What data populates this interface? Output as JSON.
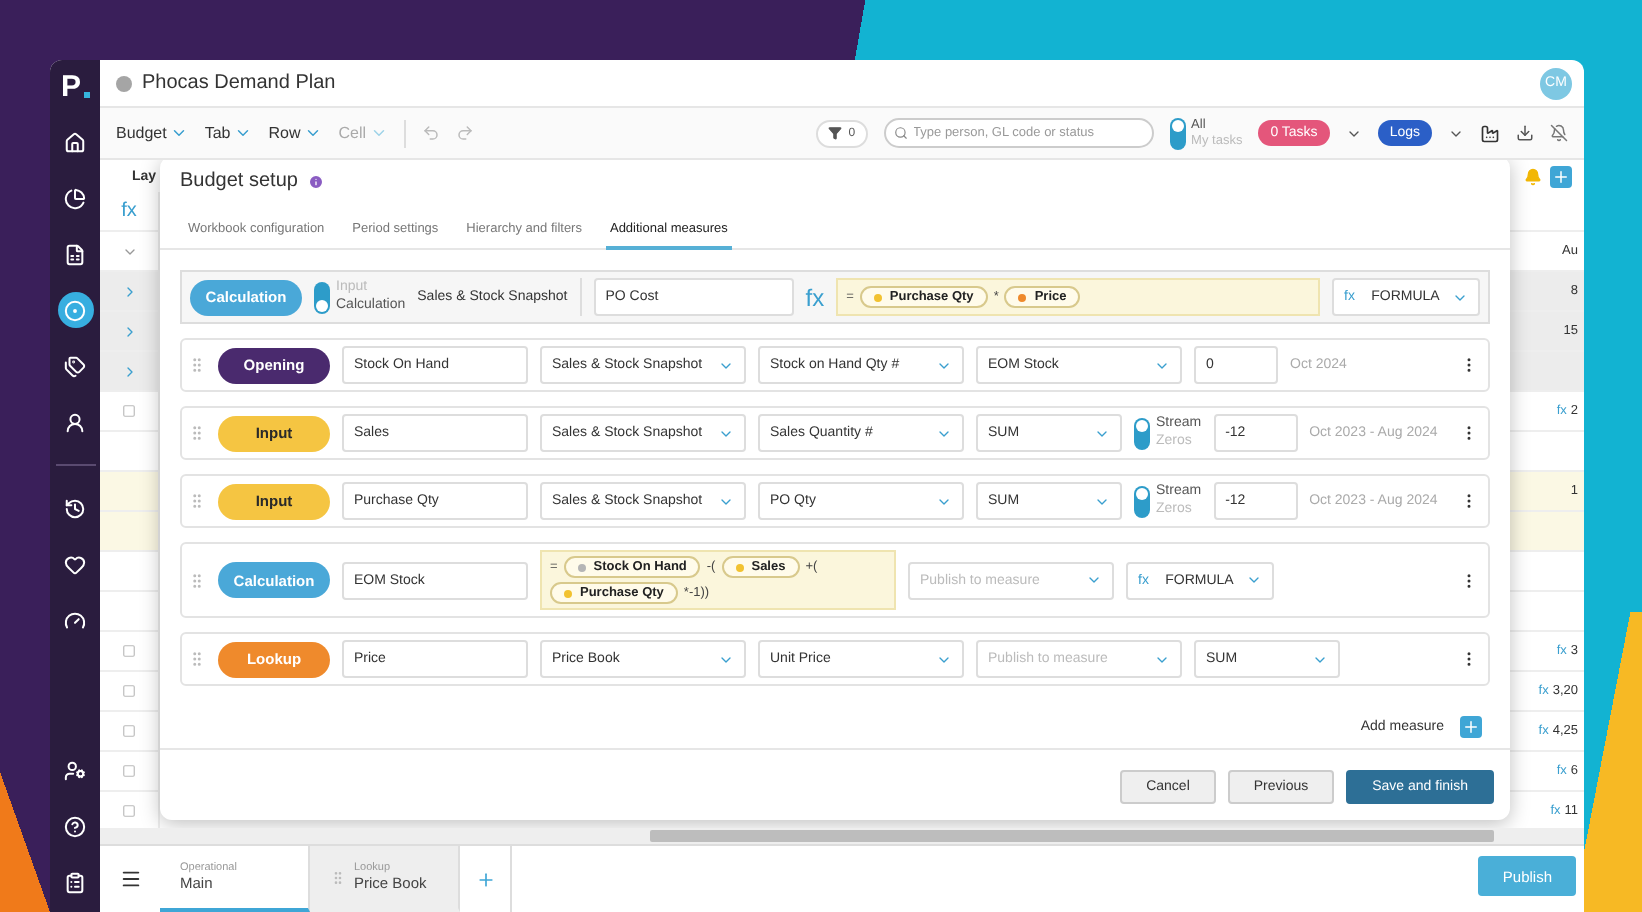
{
  "sidebar": {
    "logo": "P",
    "primary": [
      {
        "selected": false
      },
      {
        "selected": false
      },
      {
        "selected": false
      },
      {
        "selected": true
      },
      {
        "selected": false
      },
      {
        "selected": false
      }
    ],
    "secondary": [
      {
        "selected": false
      },
      {
        "selected": false
      },
      {
        "selected": false
      }
    ],
    "footer": [
      {
        "selected": false
      },
      {
        "selected": false
      },
      {
        "selected": false
      }
    ]
  },
  "window": {
    "title": "Phocas Demand Plan",
    "avatar": "CM"
  },
  "toolbar": {
    "menus": [
      {
        "label": "Budget",
        "disabled": false
      },
      {
        "label": "Tab",
        "disabled": false
      },
      {
        "label": "Row",
        "disabled": false
      },
      {
        "label": "Cell",
        "disabled": true
      }
    ],
    "filter_count": "0",
    "search": {
      "placeholder": "Type person, GL code or status"
    },
    "task_toggle": [
      {
        "label": "All",
        "selected": true
      },
      {
        "label": "My tasks",
        "selected": false
      }
    ],
    "tasks_badge": "0 Tasks",
    "logs": "Logs"
  },
  "sheet": {
    "header": "Lay",
    "rows": [
      {
        "fx": "fx",
        "shaded": false,
        "highlighted": false
      },
      {
        "kind": "chevron",
        "shaded": false,
        "highlighted": false,
        "value": "Au"
      },
      {
        "kind": "expand",
        "shaded": true,
        "highlighted": false,
        "value": "8"
      },
      {
        "kind": "expand",
        "shaded": true,
        "highlighted": false,
        "value": "15"
      },
      {
        "kind": "expand",
        "shaded": true,
        "highlighted": false
      },
      {
        "kind": "checkbox",
        "shaded": false,
        "highlighted": false,
        "prefix": "fx",
        "value": "2"
      },
      {
        "shaded": false,
        "highlighted": false
      },
      {
        "shaded": false,
        "highlighted": true,
        "value": "1"
      },
      {
        "shaded": false,
        "highlighted": true
      },
      {
        "shaded": false,
        "highlighted": false
      },
      {
        "shaded": false,
        "highlighted": false
      },
      {
        "kind": "checkbox",
        "shaded": false,
        "highlighted": false,
        "prefix": "fx",
        "value": "3"
      },
      {
        "kind": "checkbox",
        "shaded": false,
        "highlighted": false,
        "prefix": "fx",
        "value": "3,20"
      },
      {
        "kind": "checkbox",
        "shaded": false,
        "highlighted": false,
        "prefix": "fx",
        "value": "4,25"
      },
      {
        "kind": "checkbox",
        "shaded": false,
        "highlighted": false,
        "prefix": "fx",
        "value": "6"
      },
      {
        "kind": "checkbox",
        "shaded": false,
        "highlighted": false,
        "prefix": "fx",
        "value": "11"
      }
    ]
  },
  "dialog": {
    "title": "Budget setup",
    "tabs": [
      {
        "label": "Workbook configuration",
        "selected": false
      },
      {
        "label": "Period settings",
        "selected": false
      },
      {
        "label": "Hierarchy and filters",
        "selected": false
      },
      {
        "label": "Additional measures",
        "selected": true
      }
    ],
    "editor": {
      "type": "Calculation",
      "color": "#4aa8d8",
      "mode": [
        {
          "label": "Input",
          "selected": false
        },
        {
          "label": "Calculation",
          "selected": true
        }
      ],
      "source": "Sales & Stock Snapshot",
      "name": "PO Cost",
      "fx": "fx",
      "formula": [
        {
          "kind": "op",
          "text": "="
        },
        {
          "kind": "chip",
          "text": "Purchase Qty",
          "color": "#f2c230"
        },
        {
          "kind": "op",
          "text": "*"
        },
        {
          "kind": "chip",
          "text": "Price",
          "color": "#ef8a2c"
        }
      ],
      "method": {
        "prefix": "fx",
        "value": "FORMULA"
      }
    },
    "measures": [
      {
        "type": "Opening",
        "color": "#4a2a6e",
        "name": "Stock On Hand",
        "cells": [
          {
            "kind": "select",
            "value": "Sales & Stock Snapshot"
          },
          {
            "kind": "select",
            "value": "Stock on Hand Qty #"
          },
          {
            "kind": "select",
            "value": "EOM Stock"
          },
          {
            "kind": "input",
            "value": "0"
          },
          {
            "kind": "period",
            "value": "Oct 2024"
          }
        ]
      },
      {
        "type": "Input",
        "color": "#f5c542",
        "name": "Sales",
        "cells": [
          {
            "kind": "select",
            "value": "Sales & Stock Snapshot"
          },
          {
            "kind": "select",
            "value": "Sales Quantity #"
          },
          {
            "kind": "small-select",
            "value": "SUM"
          },
          {
            "kind": "toggle",
            "options": [
              {
                "label": "Stream",
                "selected": true
              },
              {
                "label": "Zeros",
                "selected": false
              }
            ]
          },
          {
            "kind": "input",
            "value": "-12"
          },
          {
            "kind": "period",
            "value": "Oct 2023 - Aug 2024"
          }
        ]
      },
      {
        "type": "Input",
        "color": "#f5c542",
        "name": "Purchase Qty",
        "cells": [
          {
            "kind": "select",
            "value": "Sales & Stock Snapshot"
          },
          {
            "kind": "select",
            "value": "PO Qty"
          },
          {
            "kind": "small-select",
            "value": "SUM"
          },
          {
            "kind": "toggle",
            "options": [
              {
                "label": "Stream",
                "selected": true
              },
              {
                "label": "Zeros",
                "selected": false
              }
            ]
          },
          {
            "kind": "input",
            "value": "-12"
          },
          {
            "kind": "period",
            "value": "Oct 2023 - Aug 2024"
          }
        ]
      },
      {
        "type": "Calculation",
        "color": "#4aa8d8",
        "name": "EOM Stock",
        "cells": [
          {
            "kind": "formula",
            "tokens": [
              {
                "kind": "op",
                "text": "="
              },
              {
                "kind": "chip",
                "text": "Stock On Hand",
                "color": "#b5b5b5"
              },
              {
                "kind": "op",
                "text": "-("
              },
              {
                "kind": "chip",
                "text": "Sales",
                "color": "#f2c230"
              },
              {
                "kind": "op",
                "text": "+("
              },
              {
                "kind": "chip",
                "text": "Purchase Qty",
                "color": "#f2c230"
              },
              {
                "kind": "op",
                "text": "*-1))"
              }
            ]
          },
          {
            "kind": "select",
            "placeholder": "Publish to measure"
          },
          {
            "kind": "fx-select",
            "prefix": "fx",
            "value": "FORMULA"
          }
        ]
      },
      {
        "type": "Lookup",
        "color": "#ef8a2c",
        "name": "Price",
        "cells": [
          {
            "kind": "select",
            "value": "Price Book"
          },
          {
            "kind": "select",
            "value": "Unit Price"
          },
          {
            "kind": "select",
            "placeholder": "Publish to measure"
          },
          {
            "kind": "small-select",
            "value": "SUM"
          }
        ]
      }
    ],
    "add_measure": "Add measure",
    "buttons": [
      {
        "label": "Cancel",
        "kind": "secondary"
      },
      {
        "label": "Previous",
        "kind": "secondary"
      },
      {
        "label": "Save and finish",
        "kind": "primary"
      }
    ]
  },
  "bottom_bar": {
    "tabs": [
      {
        "caption": "Operational",
        "label": "Main",
        "selected": true
      },
      {
        "caption": "Lookup",
        "label": "Price Book",
        "selected": false
      }
    ],
    "publish": "Publish"
  }
}
